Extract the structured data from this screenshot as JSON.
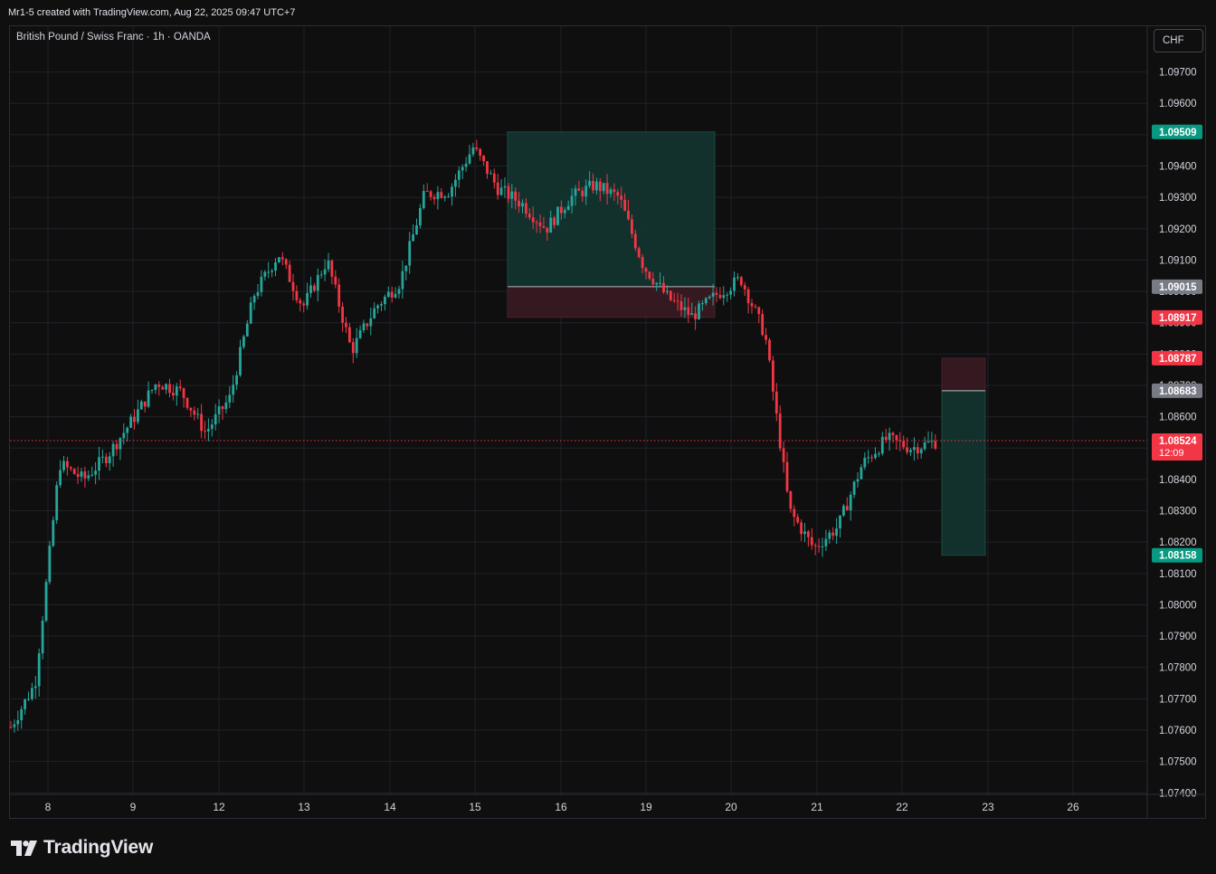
{
  "header": {
    "credit": "Mr1-5 created with TradingView.com, Aug 22, 2025 09:47 UTC+7"
  },
  "symbol": {
    "title": "British Pound / Swiss Franc · 1h · OANDA"
  },
  "currency": {
    "label": "CHF"
  },
  "footer": {
    "logo_text": "TradingView"
  },
  "colors": {
    "up": "#26a69a",
    "down": "#f23645",
    "grid": "#1f2229",
    "background": "#0f0f0f",
    "profit_zone": "#133531",
    "loss_zone": "#3a1b22"
  },
  "chart_data": {
    "type": "candlestick",
    "x_ticks": [
      "8",
      "9",
      "12",
      "13",
      "14",
      "15",
      "16",
      "19",
      "20",
      "21",
      "22",
      "23",
      "26"
    ],
    "y_ticks": [
      "1.07400",
      "1.07500",
      "1.07600",
      "1.07700",
      "1.07800",
      "1.07900",
      "1.08000",
      "1.08100",
      "1.08200",
      "1.08300",
      "1.08400",
      "1.08500",
      "1.08600",
      "1.08700",
      "1.08800",
      "1.08900",
      "1.09000",
      "1.09100",
      "1.09200",
      "1.09300",
      "1.09400",
      "1.09500",
      "1.09600",
      "1.09700"
    ],
    "ylim": [
      1.074,
      1.097
    ],
    "grid": true,
    "anchors": [
      [
        "8",
        1.0761
      ],
      [
        "8",
        1.0775
      ],
      [
        "8",
        1.0845
      ],
      [
        "8",
        1.084
      ],
      [
        "9",
        1.0848
      ],
      [
        "9",
        1.0859
      ],
      [
        "9",
        1.0871
      ],
      [
        "9",
        1.0868
      ],
      [
        "9",
        1.0855
      ],
      [
        "12",
        1.0866
      ],
      [
        "12",
        1.0899
      ],
      [
        "12",
        1.0912
      ],
      [
        "12",
        1.0895
      ],
      [
        "13",
        1.091
      ],
      [
        "13",
        1.0881
      ],
      [
        "13",
        1.0895
      ],
      [
        "14",
        1.0903
      ],
      [
        "14",
        1.0931
      ],
      [
        "14",
        1.0932
      ],
      [
        "15",
        1.0946
      ],
      [
        "15",
        1.0933
      ],
      [
        "15",
        1.0928
      ],
      [
        "16",
        1.092
      ],
      [
        "16",
        1.093
      ],
      [
        "16",
        1.0934
      ],
      [
        "19",
        1.093
      ],
      [
        "19",
        1.0908
      ],
      [
        "19",
        1.0898
      ],
      [
        "20",
        1.0892
      ],
      [
        "20",
        1.0899
      ],
      [
        "20",
        1.0904
      ],
      [
        "21",
        1.0886
      ],
      [
        "21",
        1.083
      ],
      [
        "21",
        1.0818
      ],
      [
        "21",
        1.0825
      ],
      [
        "22",
        1.0845
      ],
      [
        "22",
        1.0853
      ],
      [
        "22",
        1.085
      ],
      [
        "22",
        1.0852
      ]
    ],
    "position_long": {
      "target": 1.09509,
      "entry": 1.09015,
      "stop": 1.08917,
      "from": "15",
      "to": "19"
    },
    "position_short": {
      "stop": 1.08787,
      "entry": 1.08683,
      "target": 1.08158,
      "from": "22",
      "to": "23"
    },
    "current_price": {
      "value": 1.08524,
      "countdown": "12:09"
    },
    "price_labels": [
      {
        "value": 1.09509,
        "text": "1.09509",
        "color": "#089981"
      },
      {
        "value": 1.09015,
        "text": "1.09015",
        "color": "#787b86"
      },
      {
        "value": 1.08917,
        "text": "1.08917",
        "color": "#f23645"
      },
      {
        "value": 1.08787,
        "text": "1.08787",
        "color": "#f23645"
      },
      {
        "value": 1.08683,
        "text": "1.08683",
        "color": "#787b86"
      },
      {
        "value": 1.08158,
        "text": "1.08158",
        "color": "#089981"
      }
    ]
  }
}
